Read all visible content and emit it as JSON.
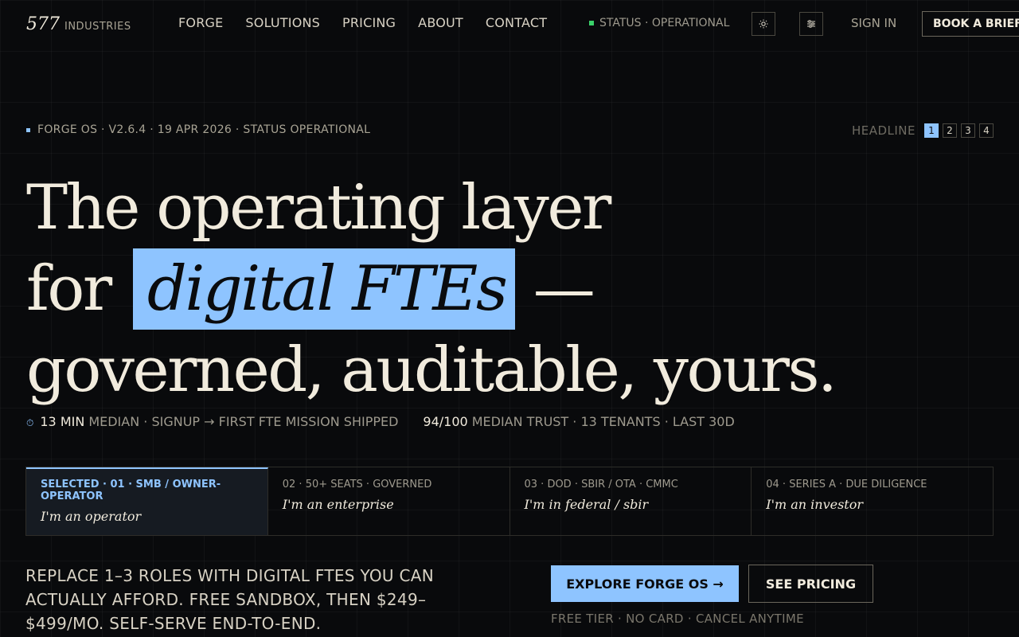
{
  "nav": {
    "logo_num": "577",
    "logo_word": "industries",
    "links": [
      "Forge",
      "Solutions",
      "Pricing",
      "About",
      "Contact"
    ],
    "status": "Status · operational",
    "theme_icon": "sun-icon",
    "settings_icon": "sliders-icon",
    "signin": "Sign in",
    "book": "Book a briefing"
  },
  "meta": {
    "text": "FORGE OS · V2.6.4 · 19 APR 2026 · STATUS OPERATIONAL",
    "headline_label": "Headline",
    "headline_options": [
      "1",
      "2",
      "3",
      "4"
    ],
    "headline_selected": "1"
  },
  "hero": {
    "line1": "The operating layer",
    "line2_pre": "for",
    "line2_highlight": "digital FTEs",
    "line2_post": "—",
    "line3": "governed, auditable, yours."
  },
  "stats": {
    "clock_icon": "⏱",
    "a_value": "13 min",
    "a_label": "median",
    "a_desc": "· SIGNUP → FIRST FTE MISSION SHIPPED",
    "b_value": "94/100",
    "b_label": "median TRUST",
    "b_desc": "· 13 tenants · last 30d"
  },
  "tabs": [
    {
      "meta": "selected · 01 · SMB / Owner-Operator",
      "title": "I'm an operator",
      "active": true
    },
    {
      "meta": "02 · 50+ seats · Governed",
      "title": "I'm an enterprise",
      "active": false
    },
    {
      "meta": "03 · DOD · SBIR / OTA · CMMC",
      "title": "I'm in federal / sbir",
      "active": false
    },
    {
      "meta": "04 · Series A · Due diligence",
      "title": "I'm an investor",
      "active": false
    }
  ],
  "pitch": "Replace 1–3 roles with digital FTEs you can actually afford. Free sandbox, then $249–$499/mo. Self-serve end-to-end.",
  "cta": {
    "primary": "Explore Forge OS →",
    "secondary": "See pricing",
    "note": "Free tier · no card · cancel anytime"
  },
  "colors": {
    "accent": "#8ec4ff",
    "background": "#090a0c",
    "text": "#f1ebdd",
    "status_ok": "#3ad26a"
  }
}
